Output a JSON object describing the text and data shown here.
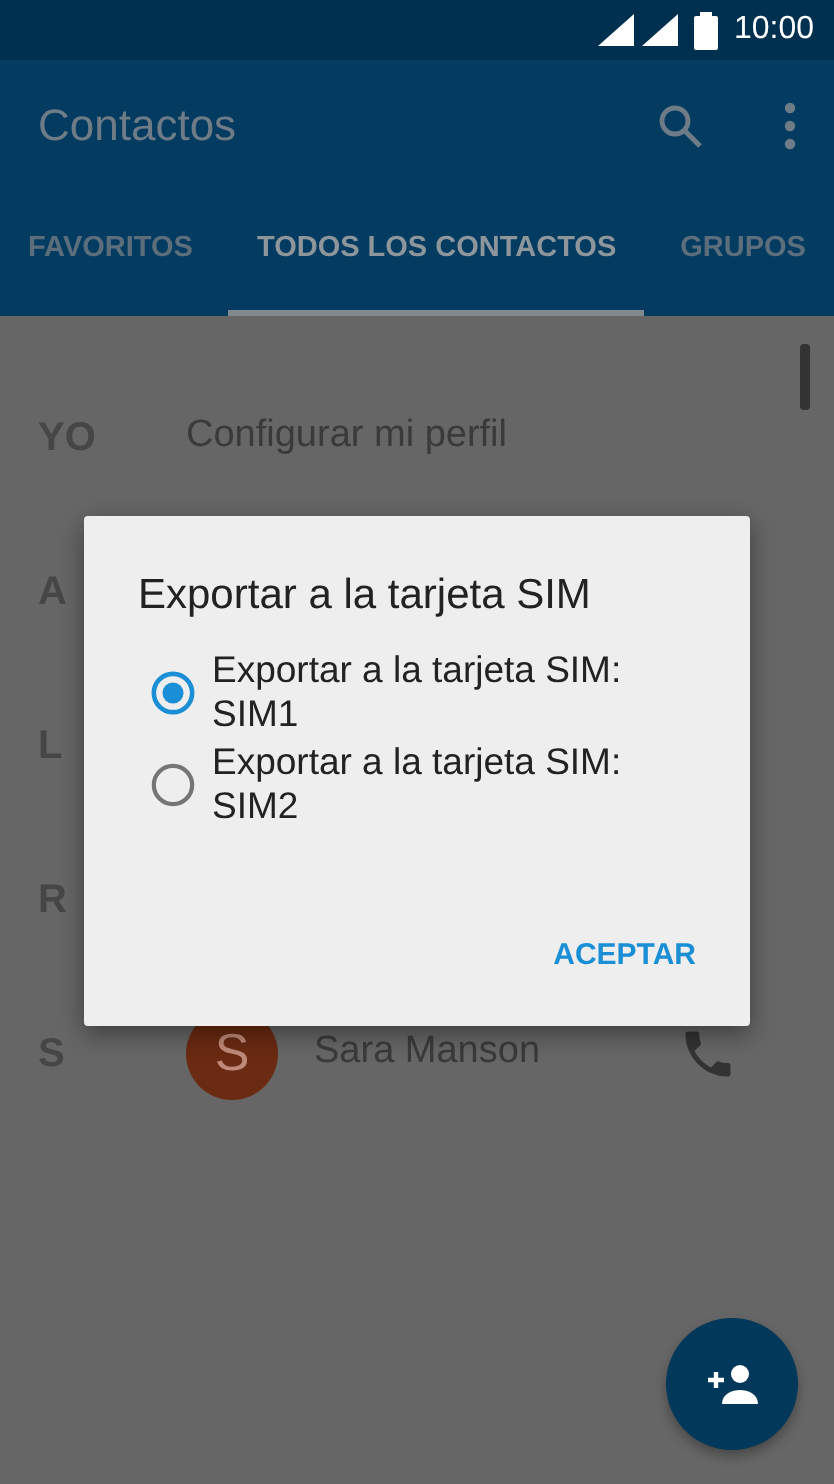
{
  "status_bar": {
    "time": "10:00"
  },
  "app_bar": {
    "title": "Contactos"
  },
  "tabs": [
    {
      "label": "FAVORITOS",
      "selected": false
    },
    {
      "label": "TODOS LOS CONTACTOS",
      "selected": true
    },
    {
      "label": "GRUPOS",
      "selected": false
    }
  ],
  "contacts": [
    {
      "letter": "YO",
      "kind": "profile",
      "name": "Configurar mi perfil"
    },
    {
      "letter": "A",
      "kind": "hidden"
    },
    {
      "letter": "L",
      "kind": "hidden"
    },
    {
      "letter": "R",
      "kind": "hidden"
    },
    {
      "letter": "S",
      "kind": "contact",
      "avatar": "S",
      "name": "Sara Manson"
    }
  ],
  "dialog": {
    "title": "Exportar a la tarjeta SIM",
    "options": [
      {
        "label": "Exportar a la tarjeta SIM: SIM1",
        "selected": true
      },
      {
        "label": "Exportar a la tarjeta SIM: SIM2",
        "selected": false
      }
    ],
    "button": "ACEPTAR"
  }
}
